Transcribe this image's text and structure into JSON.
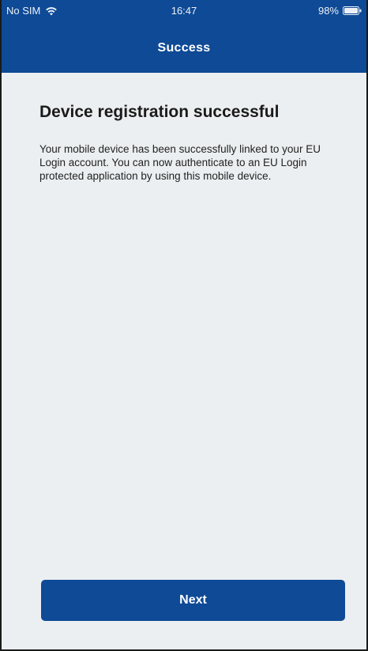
{
  "status_bar": {
    "carrier": "No SIM",
    "time": "16:47",
    "battery": "98%"
  },
  "nav": {
    "title": "Success"
  },
  "main": {
    "heading": "Device registration successful",
    "body": "Your mobile device has been successfully linked to your EU Login account. You can now authenticate to an EU Login protected application by using this mobile device."
  },
  "actions": {
    "next_label": "Next"
  },
  "colors": {
    "brand": "#0e4a96",
    "background": "#eceff1",
    "text": "#1b1b1b"
  },
  "icons": [
    "wifi-icon",
    "battery-icon"
  ]
}
